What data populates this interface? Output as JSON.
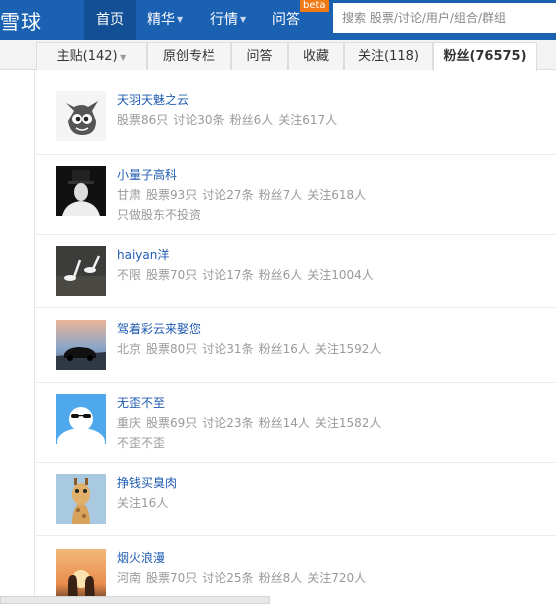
{
  "header": {
    "logo": "雪球",
    "nav": [
      {
        "label": "首页",
        "active": true
      },
      {
        "label": "精华",
        "caret": true
      },
      {
        "label": "行情",
        "caret": true
      },
      {
        "label": "问答",
        "badge": "beta"
      }
    ],
    "search_placeholder": "搜索 股票/讨论/用户/组合/群组"
  },
  "tabs": [
    {
      "label": "主贴(142)",
      "caret": true
    },
    {
      "label": "原创专栏"
    },
    {
      "label": "问答"
    },
    {
      "label": "收藏"
    },
    {
      "label": "关注(118)"
    },
    {
      "label": "粉丝(76575)",
      "active": true
    }
  ],
  "followers": [
    {
      "name": "天羽天魅之云",
      "location": "",
      "stocks": "股票86只",
      "discussions": "讨论30条",
      "fans": "粉丝6人",
      "following": "关注617人",
      "bio": ""
    },
    {
      "name": "小量子高科",
      "location": "甘肃",
      "stocks": "股票93只",
      "discussions": "讨论27条",
      "fans": "粉丝7人",
      "following": "关注618人",
      "bio": "只做股东不投资"
    },
    {
      "name": "haiyan洋",
      "location": "不限",
      "stocks": "股票70只",
      "discussions": "讨论17条",
      "fans": "粉丝6人",
      "following": "关注1004人",
      "bio": ""
    },
    {
      "name": "驾着彩云来娶您",
      "location": "北京",
      "stocks": "股票80只",
      "discussions": "讨论31条",
      "fans": "粉丝16人",
      "following": "关注1592人",
      "bio": ""
    },
    {
      "name": "无歪不至",
      "location": "重庆",
      "stocks": "股票69只",
      "discussions": "讨论23条",
      "fans": "粉丝14人",
      "following": "关注1582人",
      "bio": "不歪不歪"
    },
    {
      "name": "挣钱买臭肉",
      "location": "",
      "stocks": "",
      "discussions": "",
      "fans": "",
      "following": "关注16人",
      "bio": ""
    },
    {
      "name": "烟火浪漫",
      "location": "河南",
      "stocks": "股票70只",
      "discussions": "讨论25条",
      "fans": "粉丝8人",
      "following": "关注720人",
      "bio": ""
    }
  ]
}
